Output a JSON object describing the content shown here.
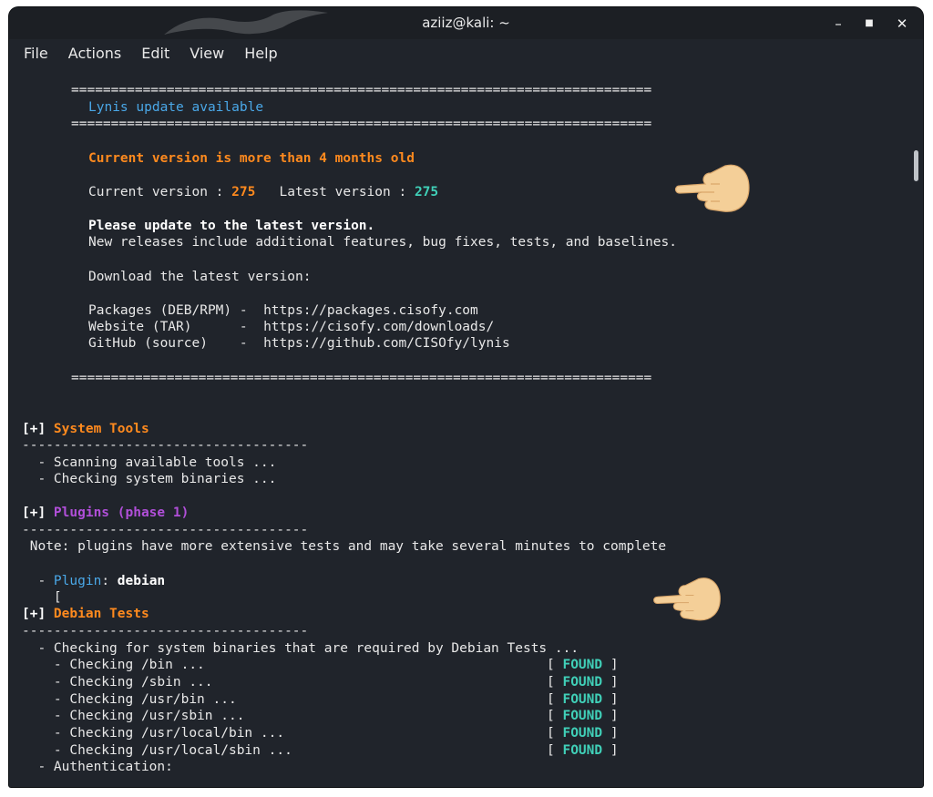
{
  "window": {
    "title": "aziiz@kali: ~",
    "controls": {
      "minimize": "–",
      "maximize": "■",
      "close": "✕"
    }
  },
  "menu": [
    "File",
    "Actions",
    "Edit",
    "View",
    "Help"
  ],
  "terminal": {
    "separator": "=========================================================================",
    "update_title": "Lynis update available",
    "age_warning": "Current version is more than 4 months old",
    "current_version_label": "Current version : ",
    "current_version_value": "275",
    "latest_version_label": "   Latest version : ",
    "latest_version_value": "275",
    "please_update": "Please update to the latest version.",
    "releases_note": "New releases include additional features, bug fixes, tests, and baselines.",
    "download_heading": "Download the latest version:",
    "links": [
      {
        "label": "Packages (DEB/RPM) -  ",
        "url": "https://packages.cisofy.com"
      },
      {
        "label": "Website (TAR)      -  ",
        "url": "https://cisofy.com/downloads/"
      },
      {
        "label": "GitHub (source)    -  ",
        "url": "https://github.com/CISOfy/lynis"
      }
    ],
    "section_prefix": "[+] ",
    "dash_line": "------------------------------------",
    "system_tools": {
      "title": "System Tools",
      "items": [
        "  - Scanning available tools ...",
        "  - Checking system binaries ..."
      ]
    },
    "plugins": {
      "title": "Plugins (phase 1)",
      "note": " Note: plugins have more extensive tests and may take several minutes to complete",
      "plugin_prefix": "  - ",
      "plugin_label": "Plugin",
      "plugin_sep": ": ",
      "plugin_name": "debian",
      "bracket": "    ["
    },
    "debian_tests": {
      "title": "Debian Tests",
      "intro": "  - Checking for system binaries that are required by Debian Tests ...",
      "checks": [
        {
          "label": "    - Checking /bin ...",
          "status": "FOUND"
        },
        {
          "label": "    - Checking /sbin ...",
          "status": "FOUND"
        },
        {
          "label": "    - Checking /usr/bin ...",
          "status": "FOUND"
        },
        {
          "label": "    - Checking /usr/sbin ...",
          "status": "FOUND"
        },
        {
          "label": "    - Checking /usr/local/bin ...",
          "status": "FOUND"
        },
        {
          "label": "    - Checking /usr/local/sbin ...",
          "status": "FOUND"
        }
      ],
      "auth": "  - Authentication:",
      "bracket_open": "[ ",
      "bracket_close": " ]"
    }
  },
  "icons": {
    "pointer": "pointing-hand-icon",
    "dragon": "kali-dragon-icon"
  },
  "colors": {
    "background": "#20242b",
    "blue": "#4aa8e8",
    "orange": "#ff8a1e",
    "purple": "#b14fd9",
    "green": "#40d0b8"
  }
}
